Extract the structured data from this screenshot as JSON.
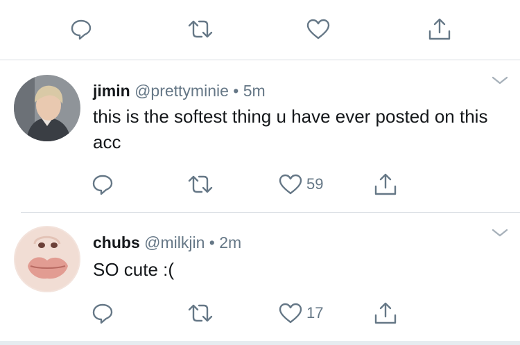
{
  "top_actions": {
    "icons": [
      "reply-icon",
      "retweet-icon",
      "like-icon",
      "share-icon"
    ]
  },
  "tweets": [
    {
      "name": "jimin",
      "handle": "@prettyminie",
      "separator": "•",
      "time": "5m",
      "text": "this is the softest thing u have ever posted on this acc",
      "like_count": "59"
    },
    {
      "name": "chubs",
      "handle": "@milkjin",
      "separator": "•",
      "time": "2m",
      "text": "SO cute :(",
      "like_count": "17"
    }
  ],
  "colors": {
    "icon": "#657786",
    "text": "#14171a",
    "secondary": "#657786",
    "divider": "#d8dde2",
    "background": "#ffffff"
  }
}
